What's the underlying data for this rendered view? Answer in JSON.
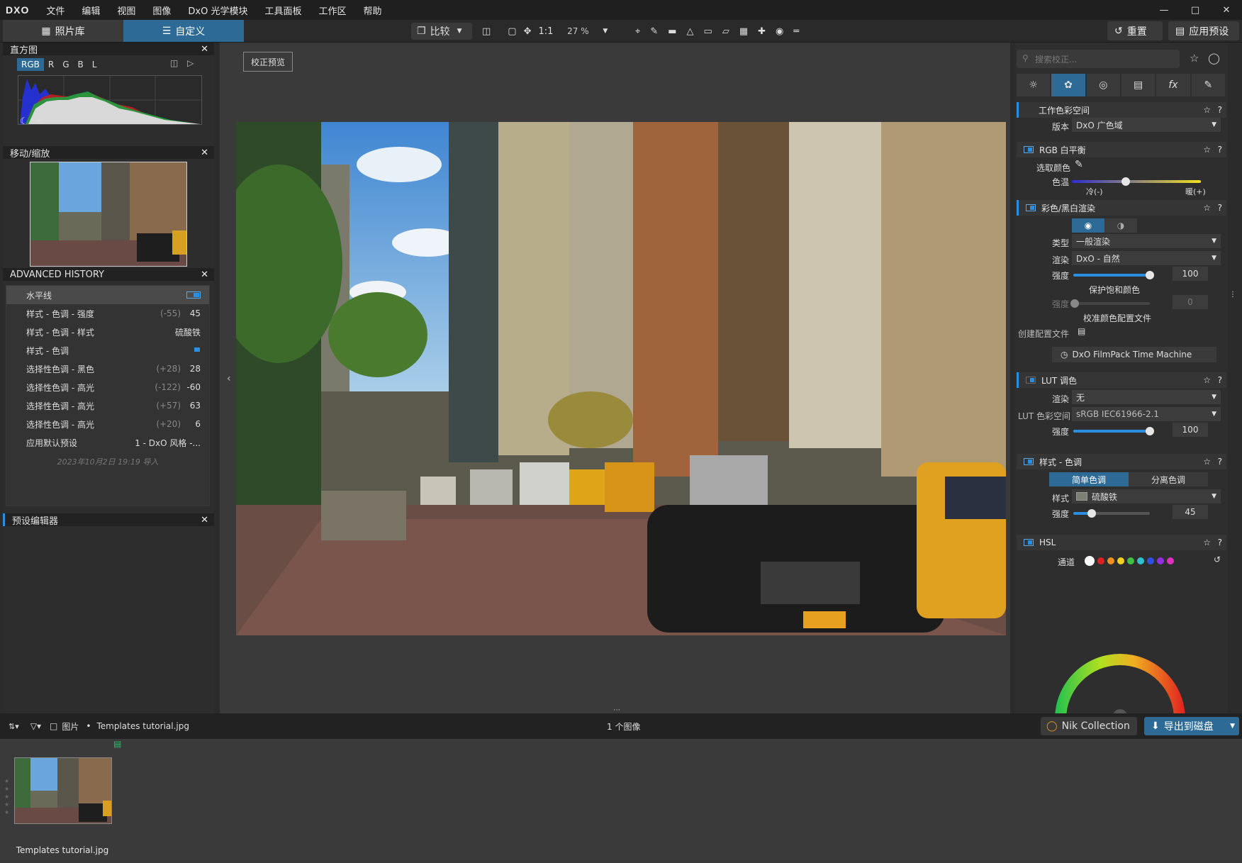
{
  "menubar": {
    "logo": "DXO",
    "items": [
      "文件",
      "编辑",
      "视图",
      "图像",
      "DxO 光学模块",
      "工具面板",
      "工作区",
      "帮助"
    ]
  },
  "toolbar": {
    "tab_library": "照片库",
    "tab_customize": "自定义",
    "compare": "比较",
    "one_to_one": "1:1",
    "zoom": "27 %",
    "reset": "重置",
    "apply_preset": "应用预设"
  },
  "histogram": {
    "title": "直方图",
    "channels": [
      "RGB",
      "R",
      "G",
      "B",
      "L"
    ]
  },
  "navigator": {
    "title": "移动/缩放"
  },
  "history": {
    "title": "ADVANCED HISTORY",
    "rows": [
      {
        "label": "水平线",
        "delta": "",
        "value": ""
      },
      {
        "label": "样式 - 色调 - 强度",
        "delta": "(-55)",
        "value": "45"
      },
      {
        "label": "样式 - 色调 - 样式",
        "delta": "",
        "value": "硫酸铁"
      },
      {
        "label": "样式 - 色调",
        "delta": "",
        "value": ""
      },
      {
        "label": "选择性色调 - 黑色",
        "delta": "(+28)",
        "value": "28"
      },
      {
        "label": "选择性色调 - 高光",
        "delta": "(-122)",
        "value": "-60"
      },
      {
        "label": "选择性色调 - 高光",
        "delta": "(+57)",
        "value": "63"
      },
      {
        "label": "选择性色调 - 高光",
        "delta": "(+20)",
        "value": "6"
      },
      {
        "label": "应用默认预设",
        "delta": "",
        "value": "1 - DxO 风格 -..."
      }
    ],
    "footer": "2023年10月2日 19:19 导入"
  },
  "preset_editor": {
    "title": "预设编辑器"
  },
  "preview_button": "校正预览",
  "right": {
    "search_placeholder": "搜索校正...",
    "working_color": {
      "title": "工作色彩空间",
      "version_label": "版本",
      "version": "DxO 广色域"
    },
    "rgb_wb": {
      "title": "RGB 白平衡",
      "pick": "选取颜色",
      "temp": "色温",
      "cold": "冷(-)",
      "warm": "暖(+)"
    },
    "color_render": {
      "title": "彩色/黑白渲染",
      "type_label": "类型",
      "type": "一般渲染",
      "render_label": "渲染",
      "render": "DxO - 自然",
      "strength_label": "强度",
      "strength": "100",
      "protect": "保护饱和颜色",
      "strength2_label": "强度",
      "strength2": "0",
      "calibrate": "校准颜色配置文件",
      "create_profile": "创建配置文件",
      "filmpack": "DxO FilmPack Time Machine"
    },
    "lut": {
      "title": "LUT 调色",
      "render_label": "渲染",
      "render": "无",
      "space_label": "LUT 色彩空间",
      "space": "sRGB IEC61966-2.1",
      "strength_label": "强度",
      "strength": "100"
    },
    "style_tone": {
      "title": "样式 - 色调",
      "tab_simple": "简单色调",
      "tab_split": "分离色调",
      "style_label": "样式",
      "style": "硫酸铁",
      "strength_label": "强度",
      "strength": "45"
    },
    "hsl": {
      "title": "HSL",
      "channel_label": "通道",
      "channels": [
        "#ffffff",
        "#e02020",
        "#f09020",
        "#f0d020",
        "#40c040",
        "#30c0d0",
        "#3050e0",
        "#9030e0",
        "#e030c0"
      ]
    }
  },
  "bottombar": {
    "folder": "图片",
    "file": "Templates tutorial.jpg",
    "count": "1 个图像",
    "nik": "Nik Collection",
    "export": "导出到磁盘"
  },
  "filmstrip": {
    "thumb_label": "Templates tutorial.jpg"
  }
}
